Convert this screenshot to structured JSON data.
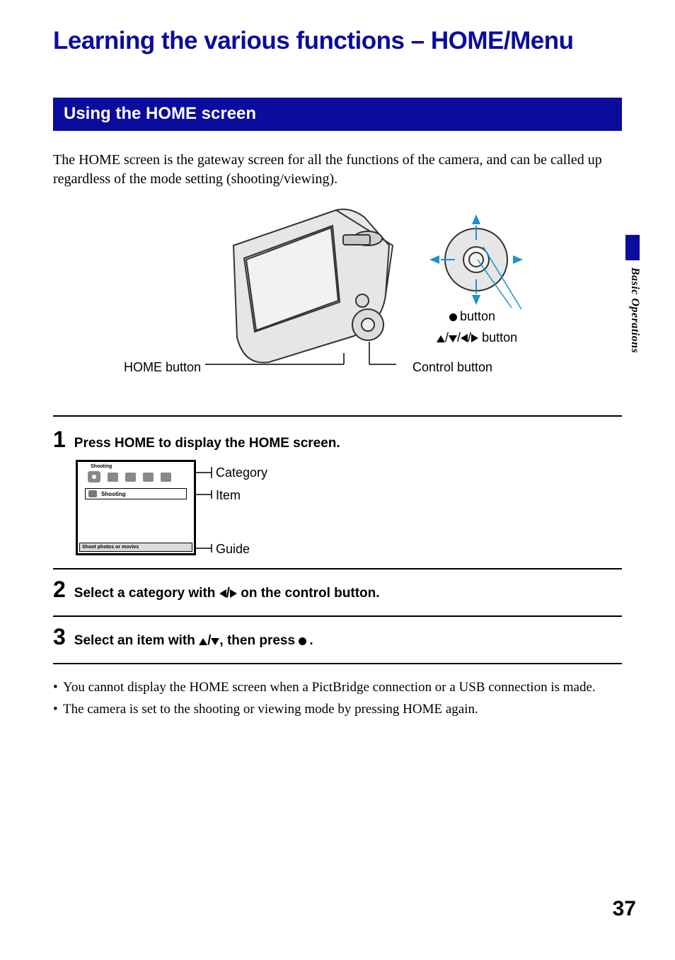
{
  "page_title": "Learning the various functions – HOME/Menu",
  "section_heading": "Using the HOME screen",
  "intro": "The HOME screen is the gateway screen for all the functions of the camera, and can be called up regardless of the mode setting (shooting/viewing).",
  "side_chapter": "Basic Operations",
  "diagram": {
    "home_button_label": "HOME button",
    "control_button_label": "Control button",
    "center_button_label": "button",
    "direction_button_label": "button"
  },
  "steps": {
    "s1": {
      "num": "1",
      "text": "Press HOME to display the HOME screen."
    },
    "s2": {
      "num": "2",
      "text": "Select a category with ◀/▶ on the control button."
    },
    "s3": {
      "num": "3",
      "text": "Select an item with ▲/▼, then press ●."
    }
  },
  "lcd": {
    "header": "Shooting",
    "item_label": "Shooting",
    "guide_text": "Shoot photos or movies"
  },
  "callouts": {
    "category": "Category",
    "item": "Item",
    "guide": "Guide"
  },
  "notes": {
    "n1": "You cannot display the HOME screen when a PictBridge connection or a USB connection is made.",
    "n2": "The camera is set to the shooting or viewing mode by pressing HOME again."
  },
  "page_number": "37"
}
